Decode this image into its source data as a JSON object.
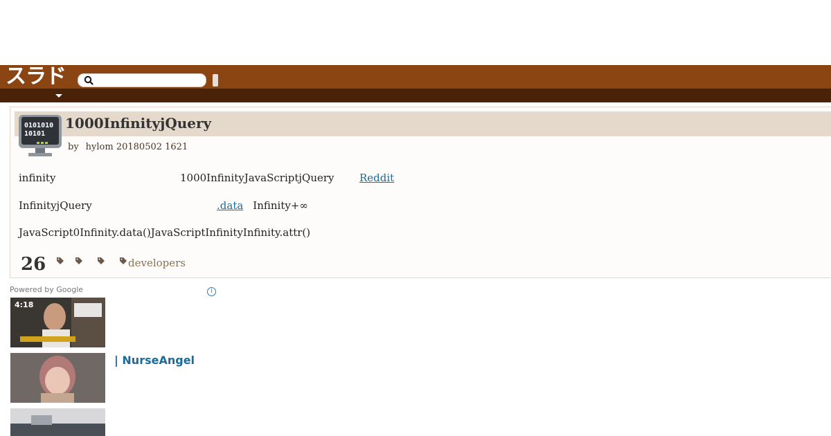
{
  "header": {
    "logo_text": "スラド",
    "search": {
      "value": "",
      "placeholder": ""
    }
  },
  "article": {
    "title": "1000InfinityjQuery",
    "byline_by": "by",
    "byline_author_date": "hylom 20180502 1621",
    "lines": [
      {
        "a": "infinity",
        "b": "1000InfinityJavaScriptjQuery",
        "link": "Reddit"
      },
      {
        "a": "InfinityjQuery",
        "link": ".data",
        "b": "Infinity+∞"
      },
      {
        "a": "JavaScript0Infinity.data()JavaScriptInfinityInfinity.attr()"
      }
    ],
    "comment_count": "26",
    "tag_label": "developers"
  },
  "ads": {
    "powered_by": "Powered by Google",
    "info_icon": "i",
    "items": [
      {
        "duration": "4:18",
        "title": ""
      },
      {
        "title": "| NurseAngel"
      },
      {
        "title": ""
      }
    ]
  },
  "colors": {
    "header_brown": "#8b4513",
    "nav_dark": "#4a2208",
    "title_band": "#e4d9cb",
    "link_blue": "#1a6ba0",
    "ad_title_blue": "#1a6b9a"
  }
}
